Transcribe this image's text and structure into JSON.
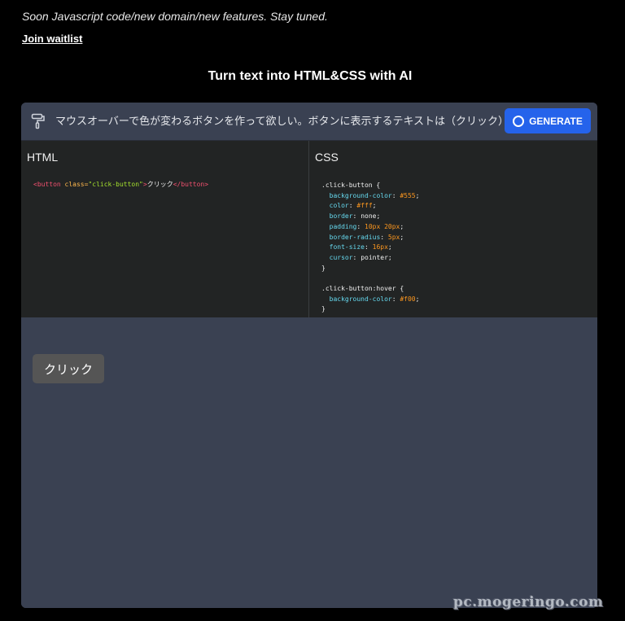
{
  "header": {
    "notice": "Soon Javascript code/new domain/new features. Stay tuned.",
    "waitlist_label": "Join waitlist",
    "headline": "Turn text into HTML&CSS with AI"
  },
  "prompt_bar": {
    "icon": "paint-roller-icon",
    "prompt_text": "マウスオーバーで色が変わるボタンを作って欲しい。ボタンに表示するテキストは（クリック）",
    "generate_label": "GENERATE",
    "generate_icon": "spinner-icon",
    "accent_color": "#2563eb"
  },
  "panels": {
    "html_title": "HTML",
    "css_title": "CSS",
    "html_code": {
      "open_tag": "<button",
      "attr_name": " class=",
      "attr_value": "\"click-button\"",
      "tag_close": ">",
      "text": "クリック",
      "end_tag": "</button>"
    },
    "css_code": {
      "rule1_selector": ".click-button {",
      "rule1": [
        {
          "prop": "background-color",
          "value": "#555"
        },
        {
          "prop": "color",
          "value": "#fff"
        },
        {
          "prop": "border",
          "value": "none"
        },
        {
          "prop": "padding",
          "value": "10px 20px"
        },
        {
          "prop": "border-radius",
          "value": "5px"
        },
        {
          "prop": "font-size",
          "value": "16px"
        },
        {
          "prop": "cursor",
          "value": "pointer"
        }
      ],
      "rule1_close": "}",
      "rule2_selector": ".click-button:hover {",
      "rule2": [
        {
          "prop": "background-color",
          "value": "#f00"
        }
      ],
      "rule2_close": "}"
    }
  },
  "preview": {
    "button_label": "クリック",
    "button_color": "#555555",
    "hover_color": "#ff0000"
  },
  "watermark": "pc.mogeringo.com"
}
